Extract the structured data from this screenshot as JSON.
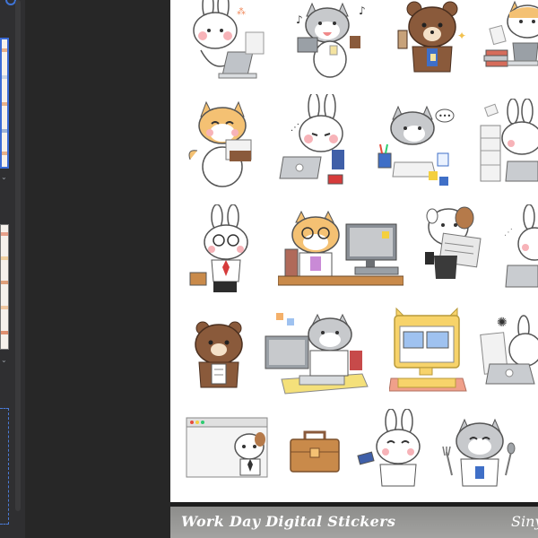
{
  "footer": {
    "title": "Work Day Digital Stickers",
    "shop": "Sinyo"
  },
  "colors": {
    "canvas": "#ffffff",
    "workspace": "#272727",
    "panel": "#2f2f31",
    "selection": "#3b6bd6",
    "bunny_blush": "#f7b3b8",
    "cat_orange": "#f4c173",
    "bear_brown": "#8a5a3b"
  },
  "stickers": [
    {
      "row": 1,
      "items": [
        "bunny-laptop-icon",
        "gray-cat-coffee-icon",
        "bear-bubble-tea-icon",
        "cat-desk-books-icon"
      ]
    },
    {
      "row": 2,
      "items": [
        "orange-cat-papers-icon",
        "bunny-laptop-thinking-icon",
        "gray-cat-writing-icon",
        "bunny-paper-stacks-icon"
      ]
    },
    {
      "row": 3,
      "items": [
        "bunny-glasses-briefcase-icon",
        "cat-glasses-computer-icon",
        "dog-newspaper-icon",
        "bunny-laptop-edge-icon"
      ]
    },
    {
      "row": 4,
      "items": [
        "bear-notepad-icon",
        "gray-cat-keyboard-icon",
        "cat-monitor-icon",
        "bunny-papers-laptop-icon"
      ]
    },
    {
      "row": 5,
      "items": [
        "browser-window-dog-icon",
        "briefcase-icon",
        "bunny-card-icon",
        "gray-cat-fork-spoon-icon"
      ]
    }
  ]
}
